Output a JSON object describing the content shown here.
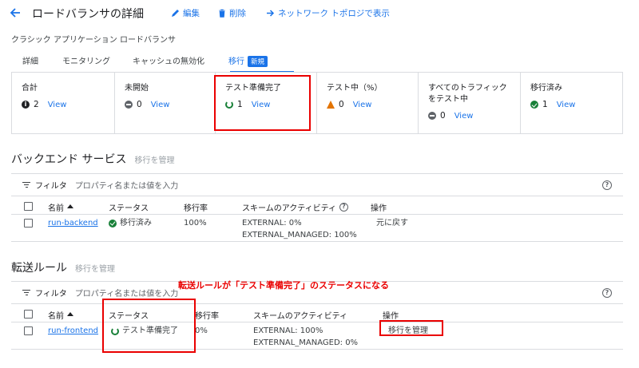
{
  "header": {
    "title": "ロードバランサの詳細",
    "edit_label": "編集",
    "delete_label": "削除",
    "topology_label": "ネットワーク トポロジで表示"
  },
  "subtitle": "クラシック アプリケーション ロードバランサ",
  "tabs": [
    {
      "label": "詳細"
    },
    {
      "label": "モニタリング"
    },
    {
      "label": "キャッシュの無効化"
    },
    {
      "label": "移行",
      "badge": "新規",
      "active": true
    }
  ],
  "stats": [
    {
      "label": "合計",
      "icon": "info-icon",
      "count": "2",
      "link": "View"
    },
    {
      "label": "未開始",
      "icon": "not-started-icon",
      "count": "0",
      "link": "View"
    },
    {
      "label": "テスト準備完了",
      "icon": "ready-icon",
      "count": "1",
      "link": "View"
    },
    {
      "label": "テスト中（%）",
      "icon": "warning-icon",
      "count": "0",
      "link": "View"
    },
    {
      "label": "すべてのトラフィックをテスト中",
      "label_lines": [
        "すべてのトラフィック",
        "をテスト中"
      ],
      "icon": "not-started-icon",
      "count": "0",
      "link": "View"
    },
    {
      "label": "移行済み",
      "icon": "check-icon",
      "count": "1",
      "link": "View"
    }
  ],
  "backend": {
    "title": "バックエンド サービス",
    "manage_link": "移行を管理",
    "filter_label": "フィルタ",
    "filter_placeholder": "プロパティ名または値を入力",
    "columns": {
      "name": "名前",
      "status": "ステータス",
      "rate": "移行率",
      "scheme": "スキームのアクティビティ",
      "ops": "操作"
    },
    "rows": [
      {
        "name": "run-backend",
        "status": "移行済み",
        "rate": "100%",
        "scheme1": "EXTERNAL: 0%",
        "scheme2": "EXTERNAL_MANAGED: 100%",
        "op": "元に戻す"
      }
    ]
  },
  "forwarding": {
    "title": "転送ルール",
    "manage_link": "移行を管理",
    "filter_label": "フィルタ",
    "filter_placeholder": "プロパティ名または値を入力",
    "columns": {
      "name": "名前",
      "status": "ステータス",
      "rate": "移行率",
      "scheme": "スキームのアクティビティ",
      "ops": "操作"
    },
    "rows": [
      {
        "name": "run-frontend",
        "status": "テスト準備完了",
        "rate": "0%",
        "scheme1": "EXTERNAL: 100%",
        "scheme2": "EXTERNAL_MANAGED: 0%",
        "op": "移行を管理"
      }
    ]
  },
  "annotation": "転送ルールが「テスト準備完了」のステータスになる",
  "colors": {
    "accent": "#1a73e8",
    "success": "#188038",
    "warning": "#e37400",
    "annotation": "#ea0000"
  }
}
